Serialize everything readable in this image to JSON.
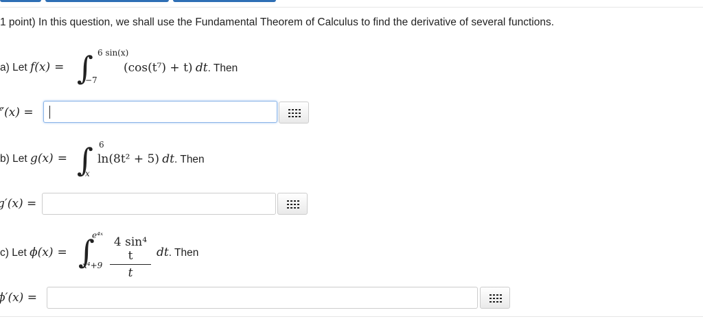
{
  "question": {
    "intro": "1 point) In this question, we shall use the Fundamental Theorem of Calculus to find the derivative of several functions."
  },
  "part_a": {
    "prefix": "a) Let ",
    "lhs": "f(x)",
    "upper": "6 sin(x)",
    "lower": "−7",
    "integrand": "(cos(t⁷) + t)",
    "differential": "dt",
    "suffix": ". Then",
    "answer_label": "f′(x) =",
    "answer_value": ""
  },
  "part_b": {
    "prefix": "b) Let ",
    "lhs": "g(x)",
    "upper": "6",
    "lower": "x",
    "integrand": "ln(8t² + 5)",
    "differential": "dt",
    "suffix": ". Then",
    "answer_label": "g′(x) =",
    "answer_value": ""
  },
  "part_c": {
    "prefix": "c) Let ",
    "lhs": "ϕ(x)",
    "upper": "e⁴ˣ",
    "lower": "x⁴+9",
    "numerator": "4 sin⁴ t",
    "denominator": "t",
    "differential": "dt",
    "suffix": ". Then",
    "answer_label": "ϕ′(x) =",
    "answer_value": ""
  },
  "icons": {
    "math_editor": "grid-icon"
  },
  "colors": {
    "accent": "#2f6fb5",
    "focus_border": "#8ab4e8",
    "input_border": "#cccccc"
  }
}
